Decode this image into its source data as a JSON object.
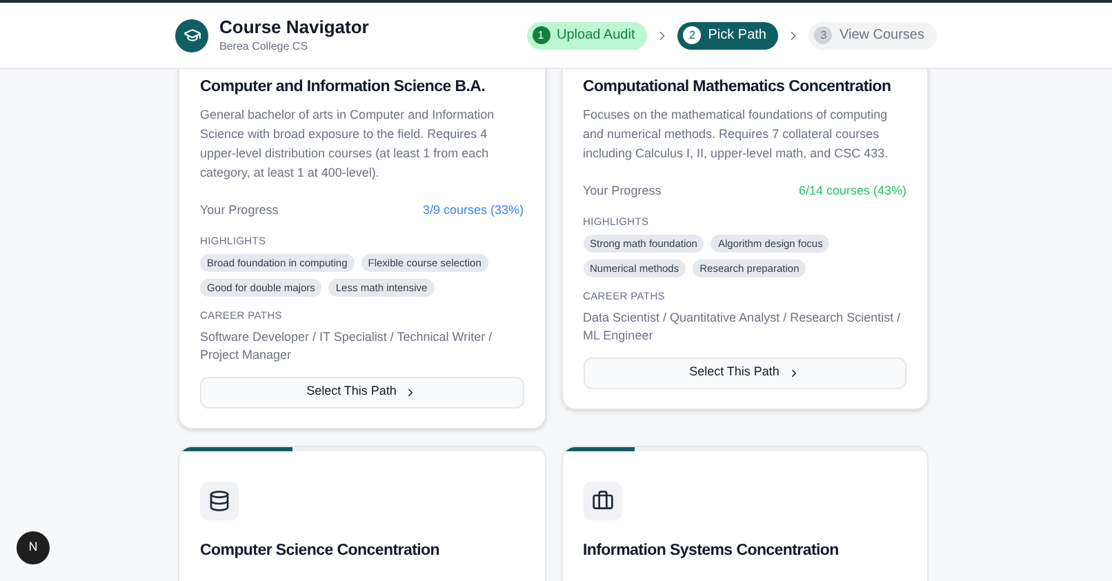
{
  "header": {
    "title": "Course Navigator",
    "subtitle": "Berea College CS"
  },
  "steps": [
    {
      "number": "1",
      "label": "Upload Audit",
      "kind": "done"
    },
    {
      "number": "2",
      "label": "Pick Path",
      "kind": "active"
    },
    {
      "number": "3",
      "label": "View Courses",
      "kind": "pending"
    }
  ],
  "paths": [
    {
      "title": "Computer and Information Science B.A.",
      "description": "General bachelor of arts in Computer and Information Science with broad exposure to the field. Requires 4 upper-level distribution courses (at least 1 from each category, at least 1 at 400-level).",
      "progress_label": "Your Progress",
      "progress": "3/9 courses (33%)",
      "color": "#3b82f6",
      "highlights_label": "HIGHLIGHTS",
      "highlights": [
        "Broad foundation in computing",
        "Flexible course selection",
        "Good for double majors",
        "Less math intensive"
      ],
      "careers_label": "CAREER PATHS",
      "careers": "Software Developer / IT Specialist / Technical Writer / Project Manager",
      "button": "Select This Path"
    },
    {
      "title": "Computational Mathematics Concentration",
      "description": "Focuses on the mathematical foundations of computing and numerical methods. Requires 7 collateral courses including Calculus I, II, upper-level math, and CSC 433.",
      "progress_label": "Your Progress",
      "progress": "6/14 courses (43%)",
      "color": "#22c55e",
      "highlights_label": "HIGHLIGHTS",
      "highlights": [
        "Strong math foundation",
        "Algorithm design focus",
        "Numerical methods",
        "Research preparation"
      ],
      "careers_label": "CAREER PATHS",
      "careers": "Data Scientist / Quantitative Analyst / Research Scientist / ML Engineer",
      "button": "Select This Path"
    }
  ],
  "more_paths": [
    {
      "kind": "database",
      "level": 0.31,
      "title": "Computer Science Concentration"
    },
    {
      "kind": "briefcase",
      "level": 0.2,
      "title": "Information Systems Concentration"
    }
  ],
  "dev_badge": "N"
}
